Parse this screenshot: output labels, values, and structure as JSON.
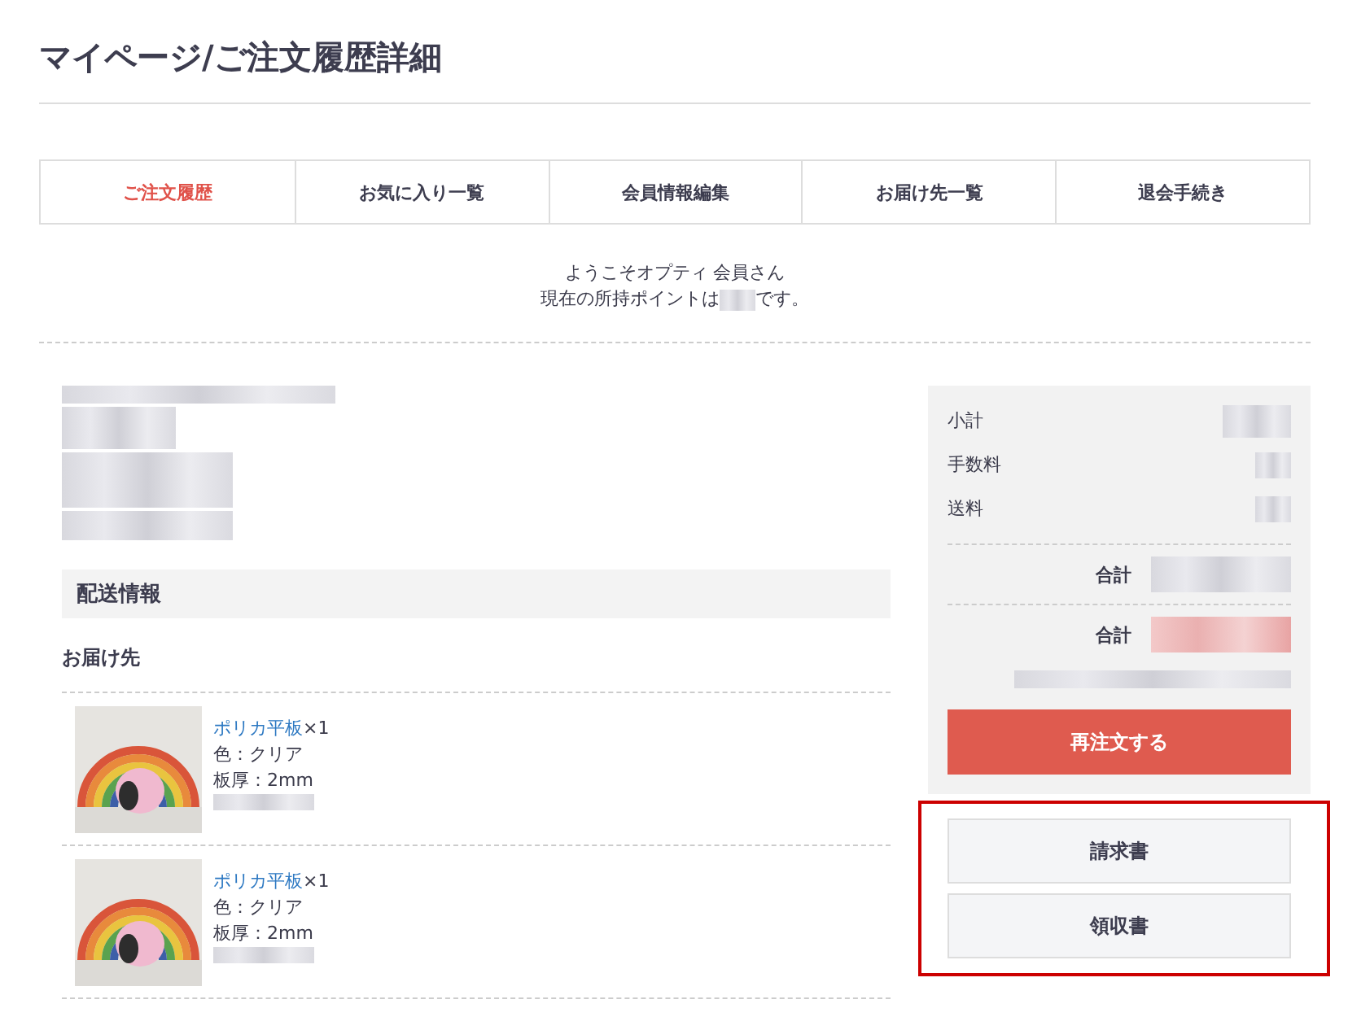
{
  "page_title": "マイページ/ご注文履歴詳細",
  "tabs": [
    {
      "label": "ご注文履歴",
      "selected": true
    },
    {
      "label": "お気に入り一覧",
      "selected": false
    },
    {
      "label": "会員情報編集",
      "selected": false
    },
    {
      "label": "お届け先一覧",
      "selected": false
    },
    {
      "label": "退会手続き",
      "selected": false
    }
  ],
  "welcome": {
    "greeting": "ようこそオプティ 会員さん",
    "points_before": "現在の所持ポイントは",
    "points_after": "です。"
  },
  "shipping": {
    "heading": "配送情報",
    "destination_label": "お届け先",
    "items": [
      {
        "name": "ポリカ平板",
        "quantity": "×1",
        "color_spec": "色：クリア",
        "thickness": "板厚：2mm"
      },
      {
        "name": "ポリカ平板",
        "quantity": "×1",
        "color_spec": "色：クリア",
        "thickness": "板厚：2mm"
      }
    ]
  },
  "summary": {
    "rows": [
      {
        "label": "小計"
      },
      {
        "label": "手数料"
      },
      {
        "label": "送料"
      }
    ],
    "totals": [
      {
        "label": "合計",
        "kind": "plain"
      },
      {
        "label": "合計",
        "kind": "accent"
      }
    ],
    "reorder_button": "再注文する"
  },
  "documents": {
    "highlighted": true,
    "buttons": [
      "請求書",
      "領収書"
    ]
  }
}
